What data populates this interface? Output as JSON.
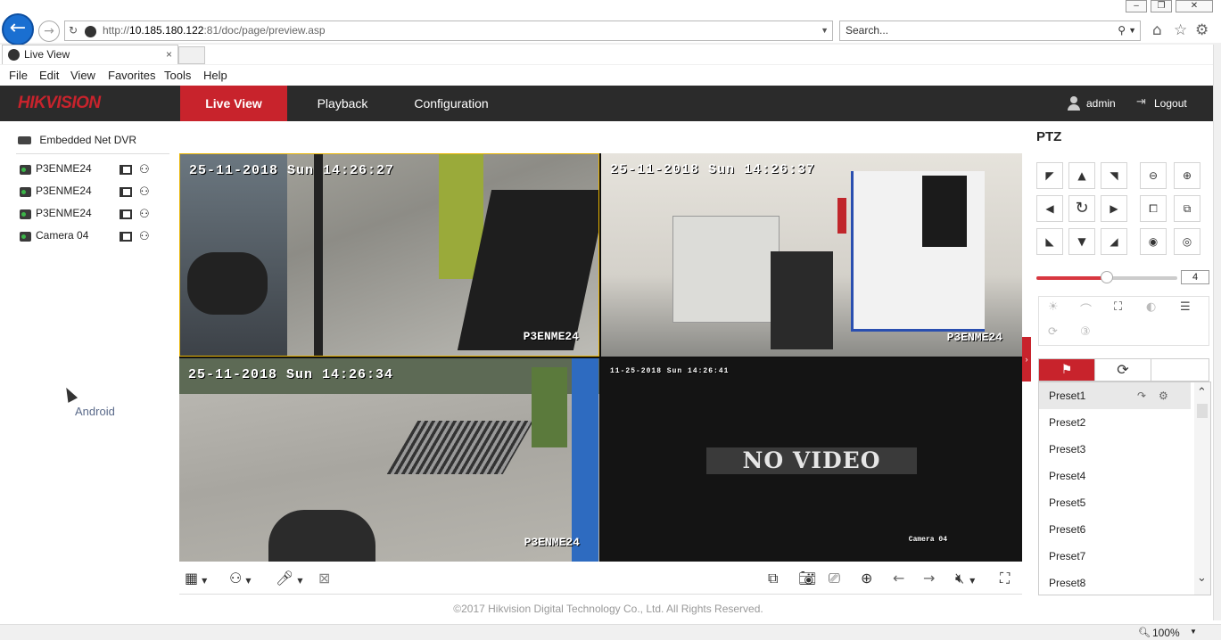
{
  "browser": {
    "url_prefix": "http://",
    "url_host": "10.185.180.122",
    "url_rest": ":81/doc/page/preview.asp",
    "search_placeholder": "Search...",
    "tab_title": "Live View",
    "menu": [
      "File",
      "Edit",
      "View",
      "Favorites",
      "Tools",
      "Help"
    ],
    "zoom": "100%"
  },
  "nav": {
    "logo": "HIKVISION",
    "tabs": [
      "Live View",
      "Playback",
      "Configuration"
    ],
    "active_tab": "Live View",
    "user": "admin",
    "logout": "Logout"
  },
  "device_tree": {
    "root": "Embedded Net DVR",
    "cameras": [
      "P3ENME24",
      "P3ENME24",
      "P3ENME24",
      "Camera 04"
    ]
  },
  "desktop_label": "Android",
  "video": {
    "tiles": [
      {
        "timestamp": "25-11-2018 Sun 14:26:27",
        "camera": "P3ENME24",
        "selected": true
      },
      {
        "timestamp": "25-11-2018 Sun 14:26:37",
        "camera": "P3ENME24",
        "selected": false
      },
      {
        "timestamp": "25-11-2018 Sun 14:26:34",
        "camera": "P3ENME24",
        "selected": false
      },
      {
        "timestamp": "11-25-2018 Sun 14:26:41",
        "camera": "Camera 04",
        "no_video": "NO VIDEO",
        "selected": false
      }
    ]
  },
  "footer": "©2017 Hikvision Digital Technology Co., Ltd. All Rights Reserved.",
  "ptz": {
    "title": "PTZ",
    "speed": "4",
    "speed_fraction": 0.5,
    "presets": [
      "Preset1",
      "Preset2",
      "Preset3",
      "Preset4",
      "Preset5",
      "Preset6",
      "Preset7",
      "Preset8"
    ]
  },
  "colors": {
    "brand_red": "#c8232c",
    "nav_bg": "#2b2b2b"
  }
}
